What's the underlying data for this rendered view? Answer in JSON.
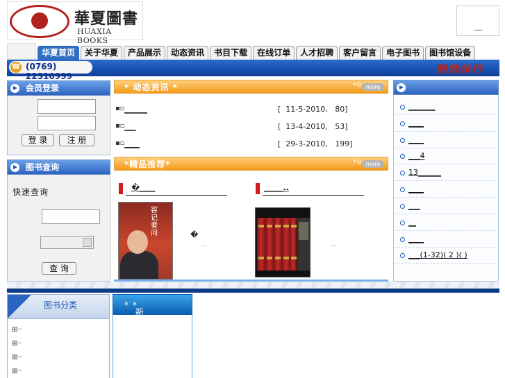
{
  "logo": {
    "cn": "華夏圖書",
    "en": "HUAXIA BOOKS"
  },
  "top_box_text": "__",
  "nav": [
    "华夏首页",
    "关于华夏",
    "产品展示",
    "动态资讯",
    "书目下载",
    "在线订单",
    "人才招聘",
    "客户留言",
    "电子图书",
    "图书馆设备"
  ],
  "phone": "(0769) 22310999",
  "bestseller_title": "畅销排行",
  "member": {
    "title": "会员登录",
    "login_label": "登 录",
    "register_label": "注 册"
  },
  "book_search": {
    "title": "图书查询",
    "quick_label": "快速查询",
    "search_label": "查 询"
  },
  "news": {
    "title": "动态资讯",
    "more": "more",
    "items": [
      {
        "title": "______",
        "date": "[  11-5-2010,   80]"
      },
      {
        "title": "___",
        "date": "[  13-4-2010,   53]"
      },
      {
        "title": "____",
        "date": "[  29-3-2010,   199]"
      }
    ]
  },
  "featured": {
    "title": "精品推荐",
    "more": "more",
    "items": [
      {
        "title": "�____",
        "cover_text": "容记者问",
        "desc": "�",
        "ellipsis": "..."
      },
      {
        "title": "_____..",
        "cover_text": "",
        "desc": "",
        "ellipsis": "..."
      }
    ]
  },
  "bestsellers": [
    "_______",
    "____",
    "____",
    "___4",
    "13______",
    "____",
    "___",
    "__",
    "____",
    "___(1-32)( 2 )( )"
  ],
  "categories": {
    "title": "图书分类",
    "rows": [
      "⊞··",
      "⊞··",
      "⊞··",
      "⊞··"
    ]
  },
  "new_books": {
    "title": "新书推荐"
  },
  "colors": {
    "nav_active": "#2f6fc0",
    "header_blue": "#0e3f98",
    "accent_orange": "#f39a1a",
    "accent_red": "#d41a1a"
  }
}
